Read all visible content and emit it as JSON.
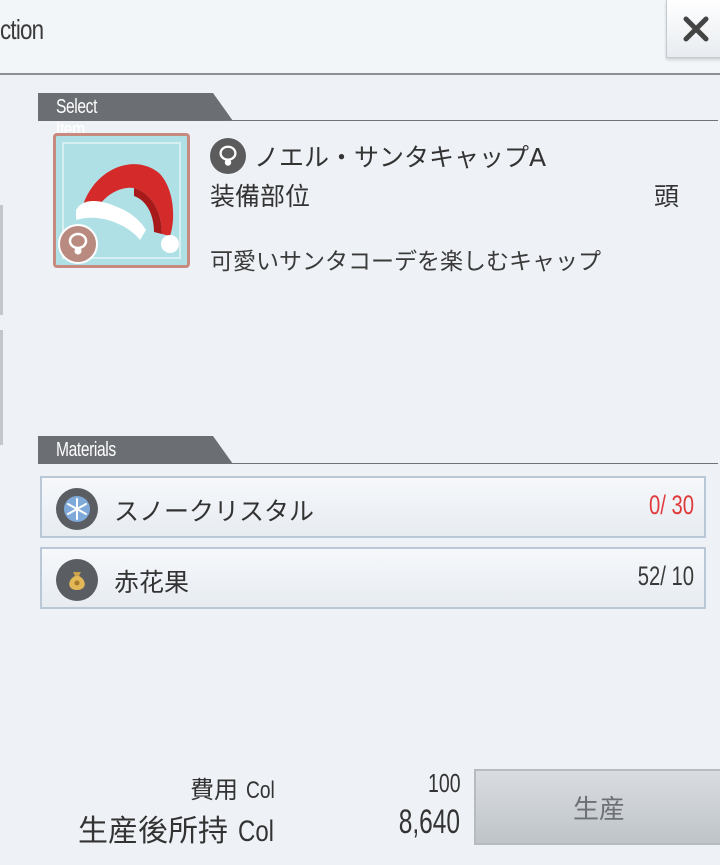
{
  "header": {
    "title": "ction",
    "close_icon": "close-icon"
  },
  "select_section": {
    "label": "Select Item"
  },
  "item": {
    "name": "ノエル・サンタキャップA",
    "equip_label": "装備部位",
    "equip_value": "頭",
    "description": "可愛いサンタコーデを楽しむキャップ",
    "icon": "necklace-icon"
  },
  "materials_section": {
    "label": "Materials"
  },
  "materials": [
    {
      "name": "スノークリスタル",
      "count": "0/ 30",
      "icon": "snowflake-icon",
      "status_color": "#e03a3a"
    },
    {
      "name": "赤花果",
      "count": "52/ 10",
      "icon": "money-bag-icon",
      "status_color": "#3a3a3a"
    }
  ],
  "footer": {
    "cost_label": "費用",
    "cost_unit": "Col",
    "cost_value": "100",
    "after_label": "生産後所持",
    "after_unit": "Col",
    "after_value": "8,640",
    "produce_button": "生産"
  }
}
